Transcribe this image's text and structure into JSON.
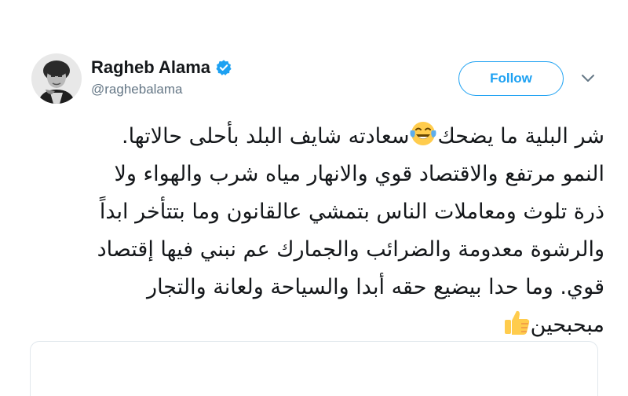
{
  "tweet": {
    "author": {
      "display_name": "Ragheb Alama",
      "handle": "@raghebalama",
      "verified": true,
      "avatar_icon": "profile-photo"
    },
    "follow_label": "Follow",
    "more_icon": "chevron-down-icon",
    "lines": [
      {
        "before": "شر البلية ما يضحك",
        "emoji": "face-with-tears-of-joy-icon",
        "after": "سعادته شايف البلد بأحلى حالاتها."
      },
      {
        "text": "النمو مرتفع والاقتصاد قوي والانهار مياه شرب والهواء ولا"
      },
      {
        "text": "ذرة تلوث ومعاملات الناس بتمشي عالقانون وما بتتأخر ابداً"
      },
      {
        "text": "والرشوة معدومة والضرائب والجمارك عم نبني فيها إقتصاد"
      },
      {
        "text": "قوي. وما حدا بيضيع حقه أبدا والسياحة ولعانة والتجار"
      },
      {
        "text": "مبحبحين",
        "emoji": "thumbs-up-icon"
      }
    ]
  },
  "colors": {
    "accent": "#1da1f2",
    "text": "#14171a",
    "secondary_text": "#657786",
    "border": "#e1e8ed"
  }
}
